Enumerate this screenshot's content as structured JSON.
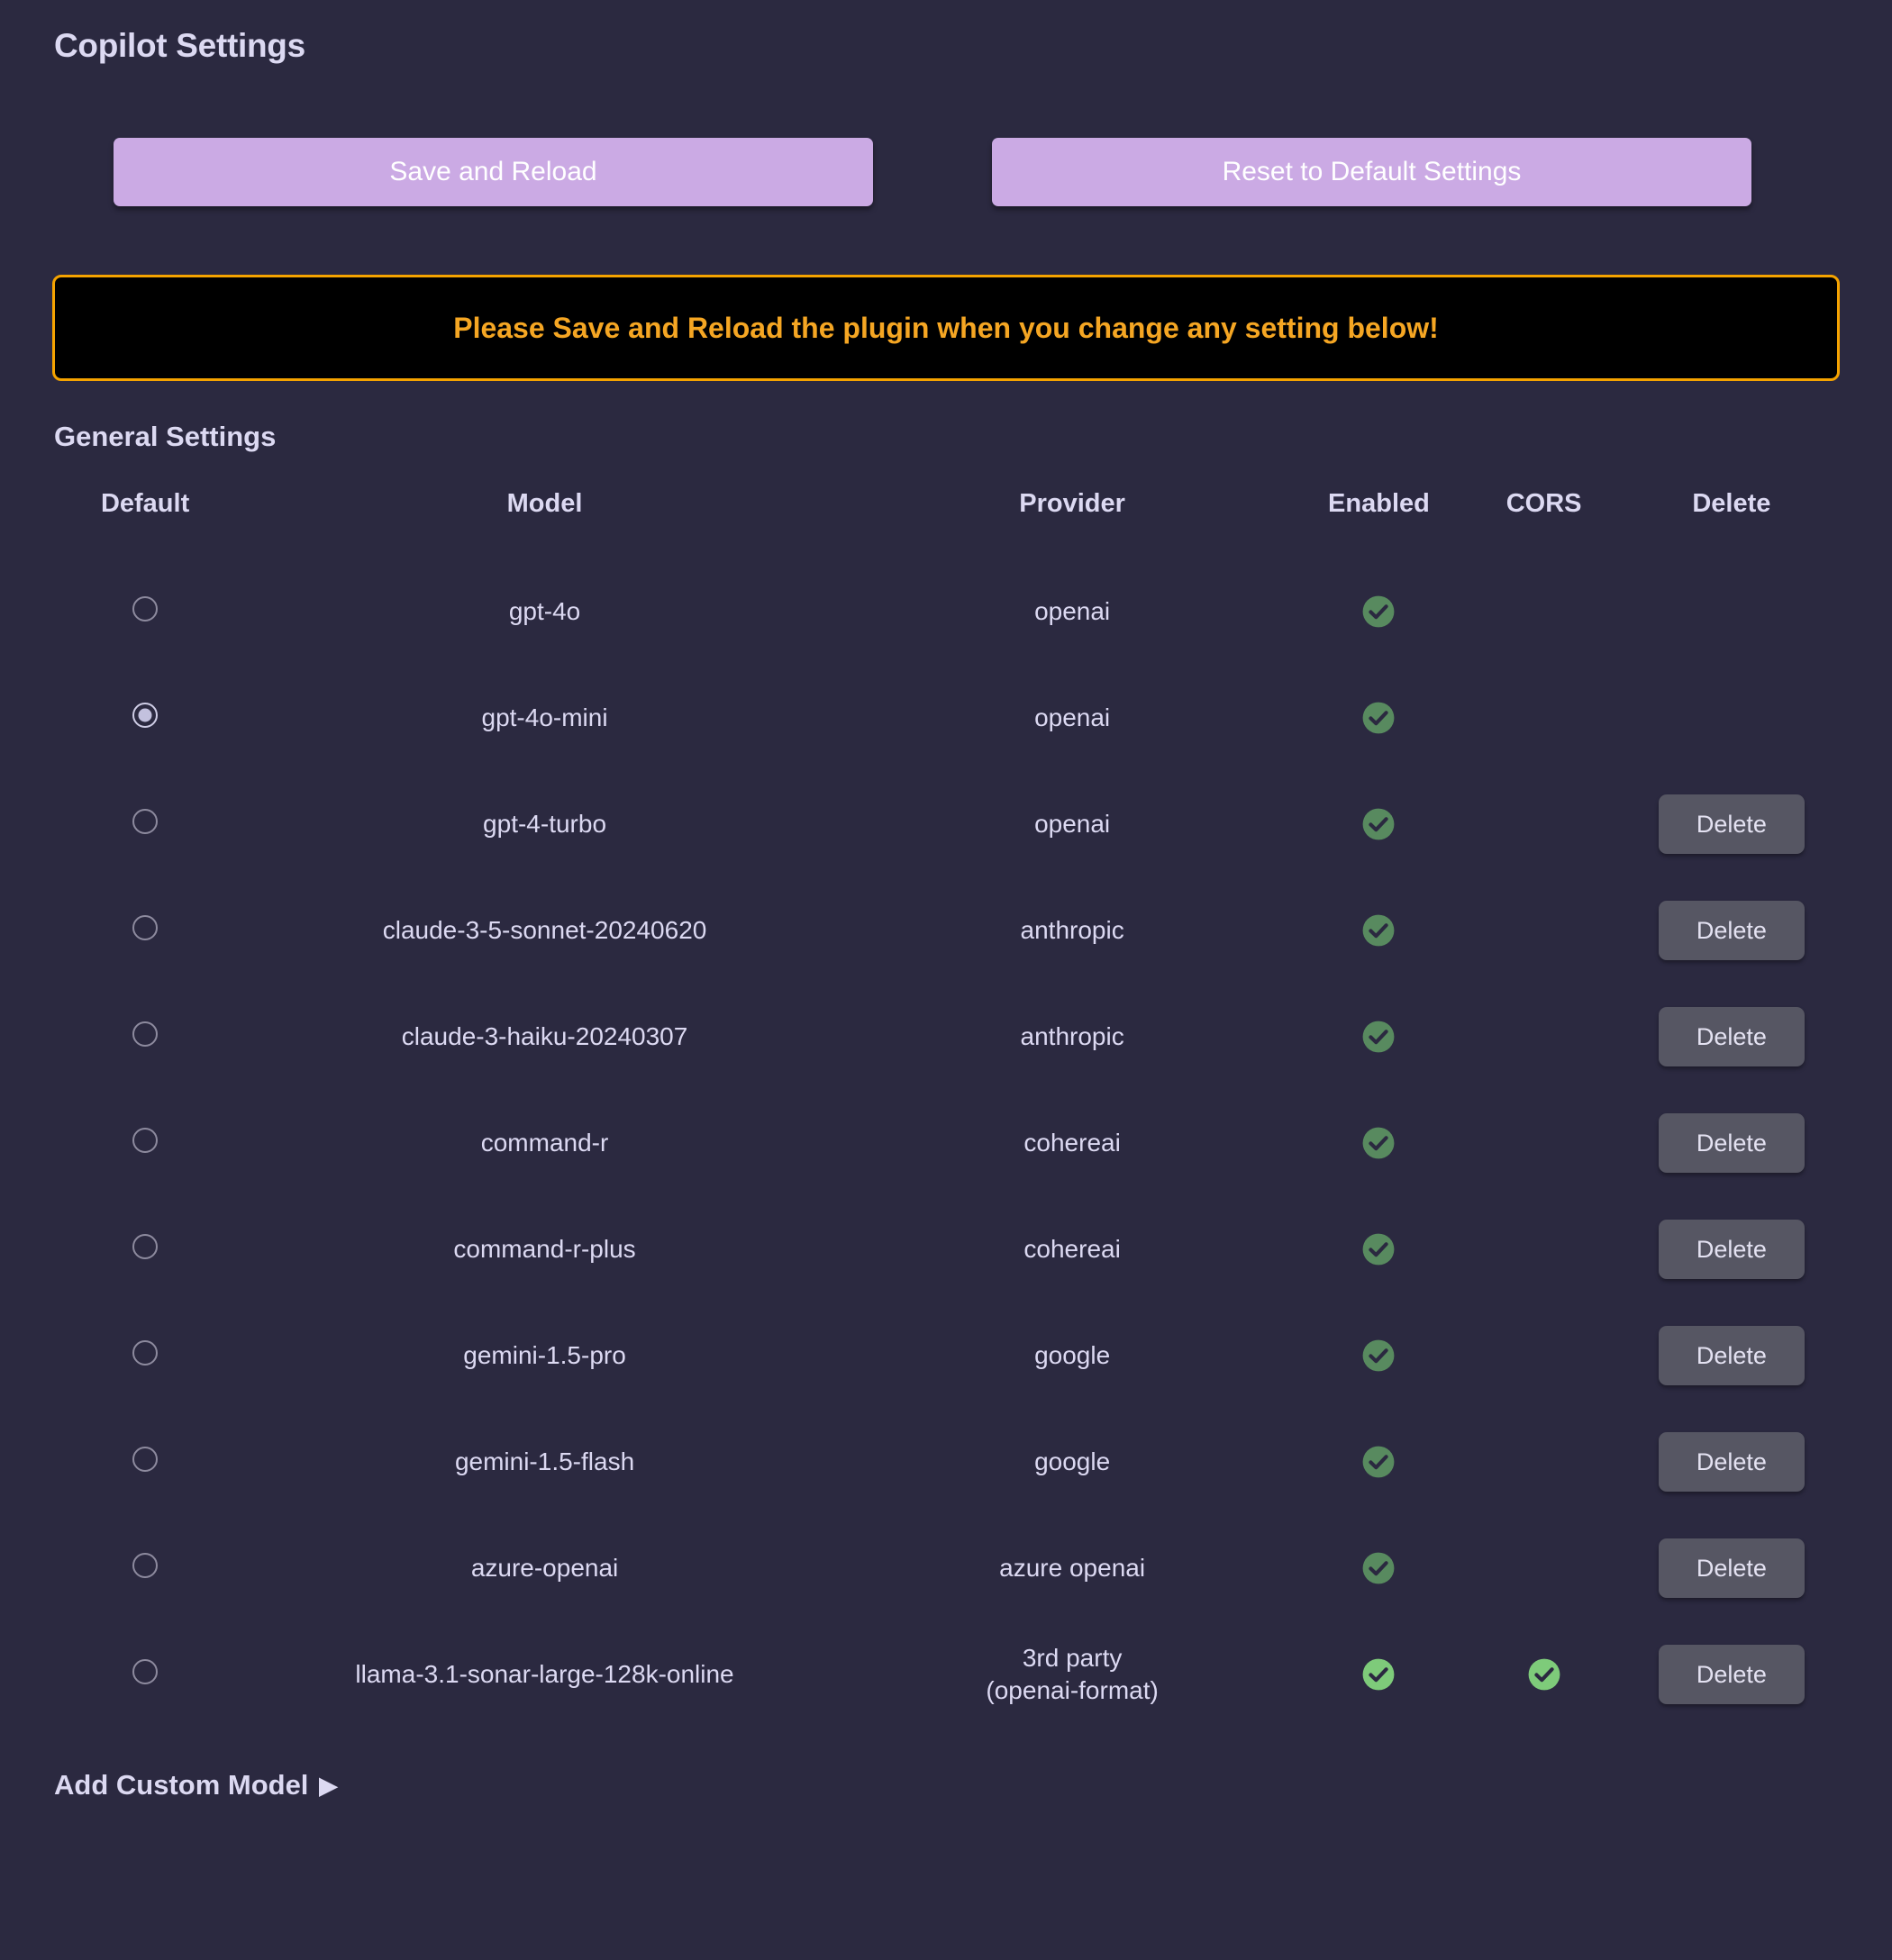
{
  "page_title": "Copilot Settings",
  "colors": {
    "background": "#2b2940",
    "text": "#dcd9f2",
    "accent_button": "#cbaae4",
    "warning_border": "#f5a300",
    "warning_text": "#f5a623",
    "warning_background": "#000000",
    "check_muted": "#588a5f",
    "check_bright": "#7ecb7a",
    "delete_button": "#565663"
  },
  "actions": {
    "save_label": "Save and Reload",
    "reset_label": "Reset to Default Settings"
  },
  "warning": {
    "message": "Please Save and Reload the plugin when you change any setting below!"
  },
  "general_settings": {
    "heading": "General Settings",
    "columns": [
      "Default",
      "Model",
      "Provider",
      "Enabled",
      "CORS",
      "Delete"
    ],
    "delete_label": "Delete",
    "rows": [
      {
        "default": false,
        "model": "gpt-4o",
        "provider": "openai",
        "enabled": true,
        "cors": false,
        "deletable": false
      },
      {
        "default": true,
        "model": "gpt-4o-mini",
        "provider": "openai",
        "enabled": true,
        "cors": false,
        "deletable": false
      },
      {
        "default": false,
        "model": "gpt-4-turbo",
        "provider": "openai",
        "enabled": true,
        "cors": false,
        "deletable": true
      },
      {
        "default": false,
        "model": "claude-3-5-sonnet-20240620",
        "provider": "anthropic",
        "enabled": true,
        "cors": false,
        "deletable": true
      },
      {
        "default": false,
        "model": "claude-3-haiku-20240307",
        "provider": "anthropic",
        "enabled": true,
        "cors": false,
        "deletable": true
      },
      {
        "default": false,
        "model": "command-r",
        "provider": "cohereai",
        "enabled": true,
        "cors": false,
        "deletable": true
      },
      {
        "default": false,
        "model": "command-r-plus",
        "provider": "cohereai",
        "enabled": true,
        "cors": false,
        "deletable": true
      },
      {
        "default": false,
        "model": "gemini-1.5-pro",
        "provider": "google",
        "enabled": true,
        "cors": false,
        "deletable": true
      },
      {
        "default": false,
        "model": "gemini-1.5-flash",
        "provider": "google",
        "enabled": true,
        "cors": false,
        "deletable": true
      },
      {
        "default": false,
        "model": "azure-openai",
        "provider": "azure openai",
        "enabled": true,
        "cors": false,
        "deletable": true
      },
      {
        "default": false,
        "model": "llama-3.1-sonar-large-128k-online",
        "provider": "3rd party (openai-format)",
        "enabled": true,
        "cors": true,
        "deletable": true,
        "bright": true
      }
    ]
  },
  "footer": {
    "add_custom_model_label": "Add Custom Model",
    "expand_icon": "▶"
  }
}
